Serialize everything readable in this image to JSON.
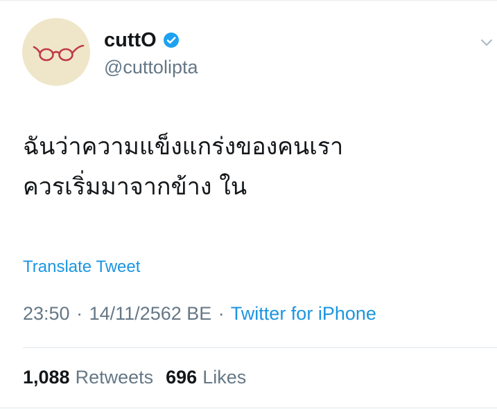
{
  "user": {
    "display_name": "cuttO",
    "handle": "@cuttolipta",
    "verified_icon": "verified-badge-icon",
    "avatar_icon": "glasses-icon"
  },
  "tweet": {
    "text_lines": [
      "ฉันว่าความแข็งแกร่งของคนเรา",
      "ควรเริ่มมาจากข้าง ใน"
    ],
    "translate_label": "Translate Tweet",
    "time": "23:50",
    "date": "14/11/2562 BE",
    "separator": "·",
    "source": "Twitter for iPhone"
  },
  "stats": {
    "retweets_count": "1,088",
    "retweets_label": "Retweets",
    "likes_count": "696",
    "likes_label": "Likes"
  },
  "colors": {
    "link": "#1b95e0",
    "secondary_text": "#657786",
    "primary_text": "#14171a",
    "verified": "#1da1f2",
    "avatar_bg": "#efe6c9",
    "glasses": "#c0394a"
  }
}
